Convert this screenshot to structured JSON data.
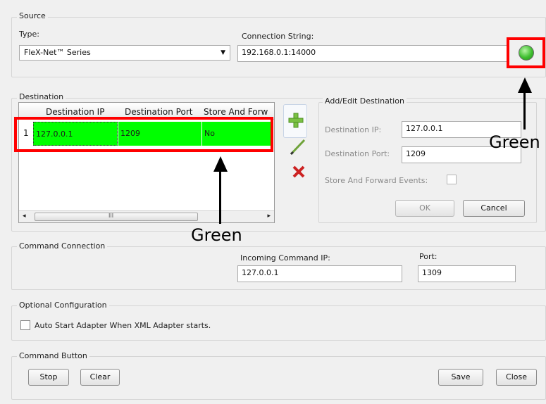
{
  "source": {
    "title": "Source",
    "type_label": "Type:",
    "type_value": "FleX-Net™ Series",
    "conn_label": "Connection String:",
    "conn_value": "192.168.0.1:14000"
  },
  "destination": {
    "title": "Destination",
    "columns": [
      "Destination IP",
      "Destination Port",
      "Store And Forw"
    ],
    "rows": [
      {
        "index": "1",
        "ip": "127.0.0.1",
        "port": "1209",
        "store": "No"
      }
    ],
    "scroll_mark": "III"
  },
  "add_edit": {
    "title": "Add/Edit Destination",
    "ip_label": "Destination IP:",
    "ip_value": "127.0.0.1",
    "port_label": "Destination Port:",
    "port_value": "1209",
    "store_label": "Store And Forward Events:",
    "ok": "OK",
    "cancel": "Cancel"
  },
  "command_connection": {
    "title": "Command Connection",
    "ip_label": "Incoming Command IP:",
    "ip_value": "127.0.0.1",
    "port_label": "Port:",
    "port_value": "1309"
  },
  "optional": {
    "title": "Optional Configuration",
    "auto_start": "Auto Start Adapter When XML Adapter starts."
  },
  "command_button": {
    "title": "Command Button",
    "stop": "Stop",
    "clear": "Clear",
    "save": "Save",
    "close": "Close"
  },
  "annotations": {
    "green_right": "Green",
    "green_bottom": "Green"
  },
  "colors": {
    "row_highlight": "#00ff00",
    "status_led": "#3fbf2f",
    "annotation_box": "#ff0000"
  },
  "icons": [
    "add-icon",
    "edit-pencil-icon",
    "delete-x-icon",
    "status-led-icon",
    "dropdown-arrow-icon"
  ]
}
